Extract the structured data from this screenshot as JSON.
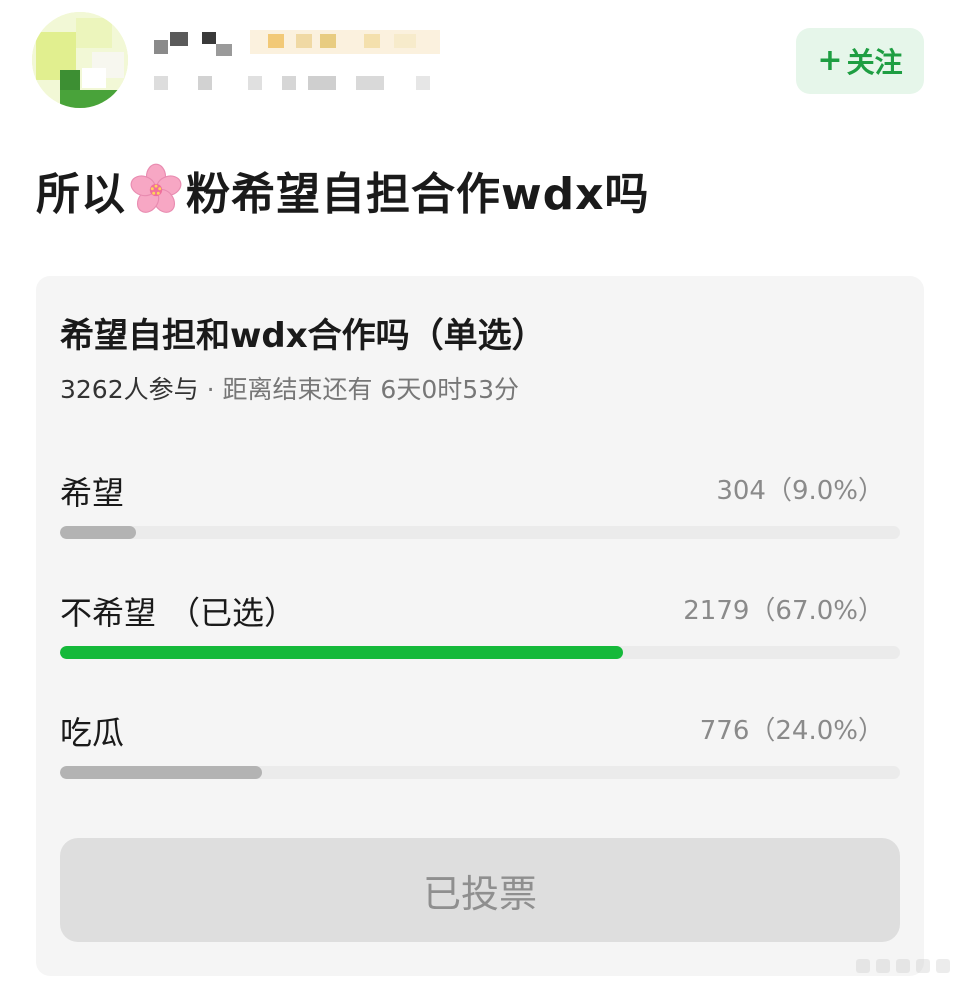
{
  "header": {
    "follow_label": "关注",
    "follow_icon": "plus-icon"
  },
  "post": {
    "title_before": "所以",
    "title_emoji": "cherry-blossom-icon",
    "title_after": "粉希望自担合作wdx吗"
  },
  "poll": {
    "question": "希望自担和wdx合作吗（单选）",
    "participants": "3262人参与",
    "separator": "·",
    "time_left": "距离结束还有 6天0时53分",
    "options": [
      {
        "label": "希望",
        "selected_tag": "",
        "count": "304（9.0%）",
        "fraction": 0.09,
        "selected": false
      },
      {
        "label": "不希望",
        "selected_tag": "（已选）",
        "count": "2179（67.0%）",
        "fraction": 0.67,
        "selected": true
      },
      {
        "label": "吃瓜",
        "selected_tag": "",
        "count": "776（24.0%）",
        "fraction": 0.24,
        "selected": false
      }
    ],
    "voted_label": "已投票"
  },
  "colors": {
    "accent_green": "#15b93a",
    "follow_bg": "#e6f6ea",
    "follow_text": "#1e9e42",
    "bar_default": "#b3b3b3"
  }
}
